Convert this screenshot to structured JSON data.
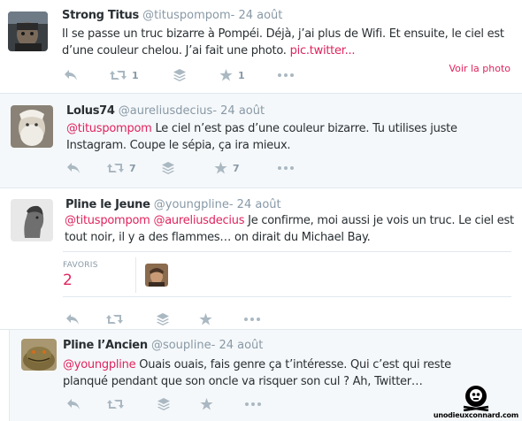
{
  "tweets": [
    {
      "name": "Strong Titus",
      "handle": "@tituspompom",
      "date": "- 24 août",
      "text_before": "Il se passe un truc bizarre à Pompéi. Déjà, j’ai plus de Wifi. Et ensuite, le ciel est d’une couleur chelou. J’ai fait une photo. ",
      "link": "pic.twitter...",
      "retweets": "1",
      "favorites": "1",
      "voir": "Voir la photo"
    },
    {
      "name": "Lolus74",
      "handle": "@aureliusdecius",
      "date": "- 24 août",
      "mention": "@tituspompom",
      "text": " Le ciel n’est pas d’une couleur bizarre. Tu utilises juste Instagram. Coupe le sépia, ça ira mieux.",
      "retweets": "7",
      "favorites": "7"
    },
    {
      "name": "Pline le Jeune",
      "handle": "@youngpline",
      "date": "- 24 août",
      "mention1": "@tituspompom",
      "mention2": "@aureliusdecius",
      "text": " Je confirme, moi aussi je vois un truc. Le ciel est tout noir, il y a des flammes… on dirait du Michael Bay.",
      "favs_label": "FAVORIS",
      "favs_count": "2"
    },
    {
      "name": "Pline l’Ancien",
      "handle": "@soupline",
      "date": "- 24 août",
      "mention": "@youngpline",
      "text": "  Ouais ouais, fais genre ça t’intéresse. Qui c’est qui reste planqué pendant que son oncle va risquer son cul ? Ah, Twitter…"
    }
  ],
  "watermark": "unodieuxconnard.com"
}
